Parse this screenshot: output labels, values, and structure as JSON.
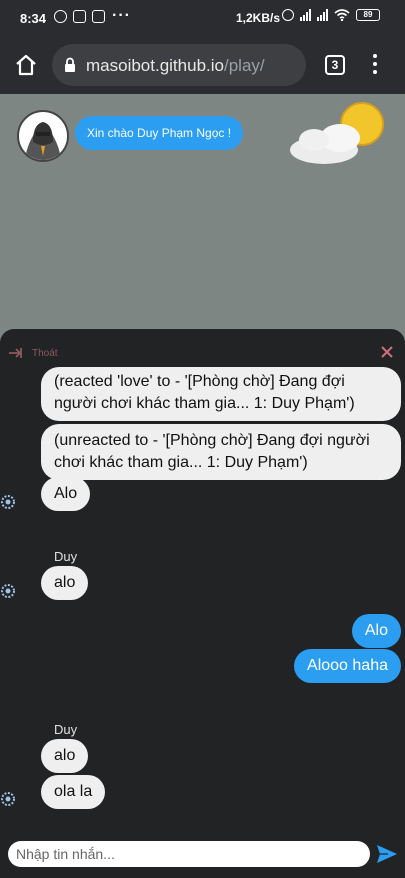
{
  "status_bar": {
    "time": "8:34",
    "speed": "1,2KB/s",
    "battery": "89"
  },
  "browser": {
    "url_host": "masoibot.github.io",
    "url_path": "/play/",
    "tab_count": "3"
  },
  "game": {
    "greeting": "Xin chào Duy Phạm Ngọc !"
  },
  "chat": {
    "exit_label": "Thoát",
    "messages": [
      {
        "text": "(reacted 'love' to - '[Phòng chờ] Đang đợi người chơi khác tham gia... 1: Duy Phạm')"
      },
      {
        "text": "(unreacted to - '[Phòng chờ] Đang đợi người chơi khác tham gia... 1: Duy Phạm')"
      },
      {
        "text": "Alo"
      },
      {
        "sender": "Duy",
        "text": "alo"
      },
      {
        "text": "Alo"
      },
      {
        "text": "Alooo haha"
      },
      {
        "sender": "Duy",
        "text": "alo"
      },
      {
        "text": "ola la"
      }
    ],
    "input_placeholder": "Nhập tin nhắn...",
    "input_value": ""
  },
  "colors": {
    "accent": "#2b9ef2",
    "exit": "#8c5a5f",
    "close": "#d0707a"
  }
}
